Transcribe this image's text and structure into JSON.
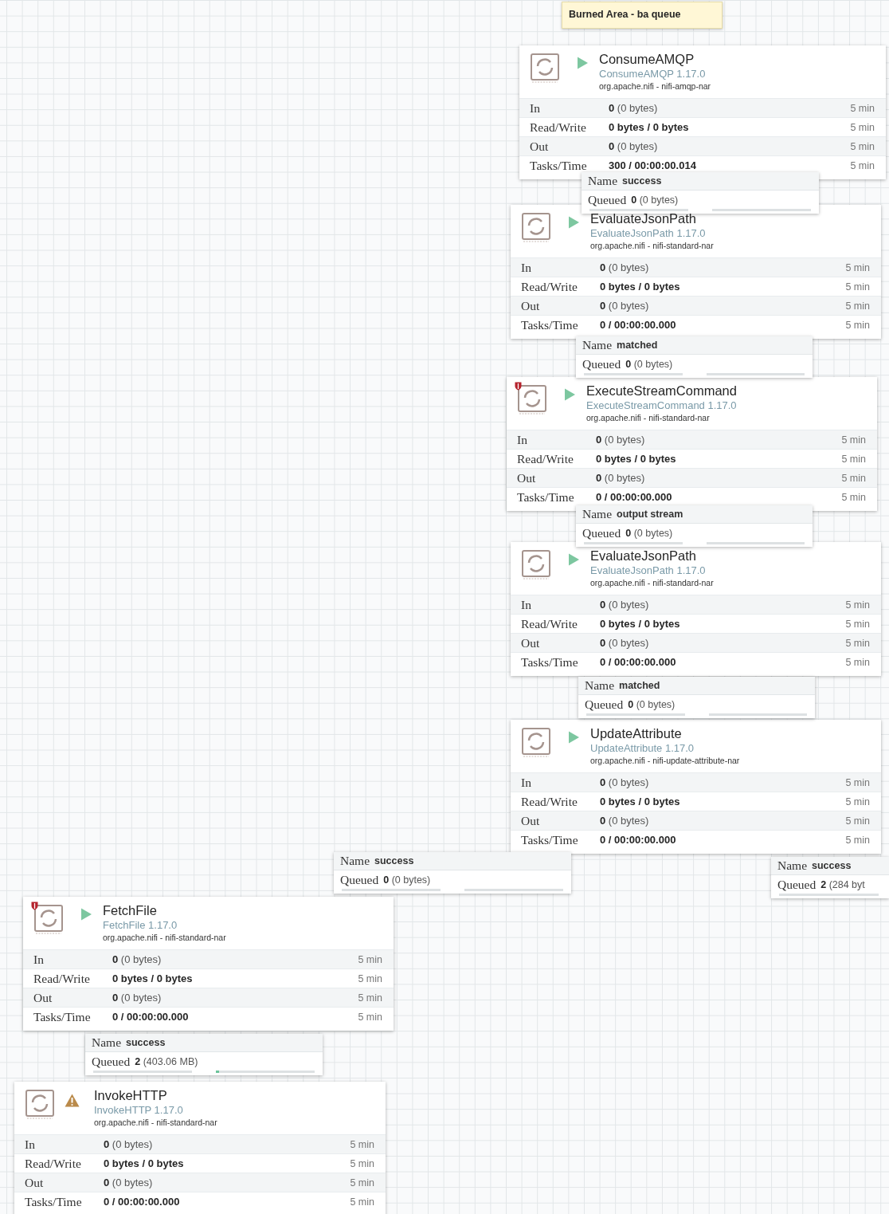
{
  "note": {
    "text": "Burned Area - ba queue"
  },
  "processors": [
    {
      "name": "ConsumeAMQP",
      "type": "ConsumeAMQP 1.17.0",
      "bundle": "org.apache.nifi - nifi-amqp-nar",
      "kind": "running",
      "restricted": false,
      "stats": [
        {
          "label": "In",
          "value": "**0** (0 bytes)",
          "window": "5 min"
        },
        {
          "label": "Read/Write",
          "value": "0 bytes / 0 bytes",
          "window": "5 min"
        },
        {
          "label": "Out",
          "value": "**0** (0 bytes)",
          "window": "5 min"
        },
        {
          "label": "Tasks/Time",
          "value": "300 / 00:00:00.014",
          "window": "5 min"
        }
      ]
    },
    {
      "name": "EvaluateJsonPath",
      "type": "EvaluateJsonPath 1.17.0",
      "bundle": "org.apache.nifi - nifi-standard-nar",
      "kind": "running",
      "restricted": false,
      "stats": [
        {
          "label": "In",
          "value": "**0** (0 bytes)",
          "window": "5 min"
        },
        {
          "label": "Read/Write",
          "value": "0 bytes / 0 bytes",
          "window": "5 min"
        },
        {
          "label": "Out",
          "value": "**0** (0 bytes)",
          "window": "5 min"
        },
        {
          "label": "Tasks/Time",
          "value": "0 / 00:00:00.000",
          "window": "5 min"
        }
      ]
    },
    {
      "name": "ExecuteStreamCommand",
      "type": "ExecuteStreamCommand 1.17.0",
      "bundle": "org.apache.nifi - nifi-standard-nar",
      "kind": "running",
      "restricted": true,
      "stats": [
        {
          "label": "In",
          "value": "**0** (0 bytes)",
          "window": "5 min"
        },
        {
          "label": "Read/Write",
          "value": "0 bytes / 0 bytes",
          "window": "5 min"
        },
        {
          "label": "Out",
          "value": "**0** (0 bytes)",
          "window": "5 min"
        },
        {
          "label": "Tasks/Time",
          "value": "0 / 00:00:00.000",
          "window": "5 min"
        }
      ]
    },
    {
      "name": "EvaluateJsonPath",
      "type": "EvaluateJsonPath 1.17.0",
      "bundle": "org.apache.nifi - nifi-standard-nar",
      "kind": "running",
      "restricted": false,
      "stats": [
        {
          "label": "In",
          "value": "**0** (0 bytes)",
          "window": "5 min"
        },
        {
          "label": "Read/Write",
          "value": "0 bytes / 0 bytes",
          "window": "5 min"
        },
        {
          "label": "Out",
          "value": "**0** (0 bytes)",
          "window": "5 min"
        },
        {
          "label": "Tasks/Time",
          "value": "0 / 00:00:00.000",
          "window": "5 min"
        }
      ]
    },
    {
      "name": "UpdateAttribute",
      "type": "UpdateAttribute 1.17.0",
      "bundle": "org.apache.nifi - nifi-update-attribute-nar",
      "kind": "running",
      "restricted": false,
      "stats": [
        {
          "label": "In",
          "value": "**0** (0 bytes)",
          "window": "5 min"
        },
        {
          "label": "Read/Write",
          "value": "0 bytes / 0 bytes",
          "window": "5 min"
        },
        {
          "label": "Out",
          "value": "**0** (0 bytes)",
          "window": "5 min"
        },
        {
          "label": "Tasks/Time",
          "value": "0 / 00:00:00.000",
          "window": "5 min"
        }
      ]
    },
    {
      "name": "FetchFile",
      "type": "FetchFile 1.17.0",
      "bundle": "org.apache.nifi - nifi-standard-nar",
      "kind": "running",
      "restricted": true,
      "stats": [
        {
          "label": "In",
          "value": "**0** (0 bytes)",
          "window": "5 min"
        },
        {
          "label": "Read/Write",
          "value": "0 bytes / 0 bytes",
          "window": "5 min"
        },
        {
          "label": "Out",
          "value": "**0** (0 bytes)",
          "window": "5 min"
        },
        {
          "label": "Tasks/Time",
          "value": "0 / 00:00:00.000",
          "window": "5 min"
        }
      ]
    },
    {
      "name": "InvokeHTTP",
      "type": "InvokeHTTP 1.17.0",
      "bundle": "org.apache.nifi - nifi-standard-nar",
      "kind": "invalid",
      "restricted": false,
      "stats": [
        {
          "label": "In",
          "value": "**0** (0 bytes)",
          "window": "5 min"
        },
        {
          "label": "Read/Write",
          "value": "0 bytes / 0 bytes",
          "window": "5 min"
        },
        {
          "label": "Out",
          "value": "**0** (0 bytes)",
          "window": "5 min"
        },
        {
          "label": "Tasks/Time",
          "value": "0 / 00:00:00.000",
          "window": "5 min"
        }
      ]
    }
  ],
  "connections": [
    {
      "name_label": "Name",
      "name": "success",
      "queued_label": "Queued",
      "queued": "**0** (0 bytes)"
    },
    {
      "name_label": "Name",
      "name": "matched",
      "queued_label": "Queued",
      "queued": "**0** (0 bytes)"
    },
    {
      "name_label": "Name",
      "name": "output stream",
      "queued_label": "Queued",
      "queued": "**0** (0 bytes)"
    },
    {
      "name_label": "Name",
      "name": "matched",
      "queued_label": "Queued",
      "queued": "**0** (0 bytes)"
    },
    {
      "name_label": "Name",
      "name": "success",
      "queued_label": "Queued",
      "queued": "**0** (0 bytes)"
    },
    {
      "name_label": "Name",
      "name": "success",
      "queued_label": "Queued",
      "queued": "**2** (284 byt"
    },
    {
      "name_label": "Name",
      "name": "success",
      "queued_label": "Queued",
      "queued": "**2** (403.06 MB)",
      "level": 0.03
    }
  ]
}
